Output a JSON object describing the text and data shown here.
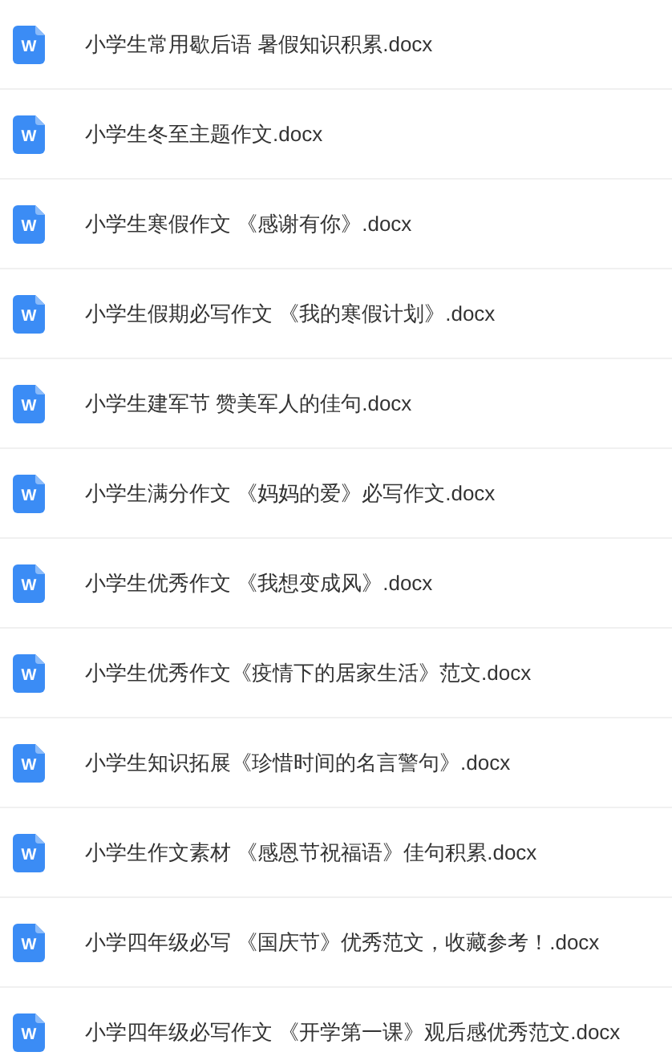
{
  "files": [
    {
      "icon_label": "W",
      "name": "小学生常用歇后语 暑假知识积累.docx"
    },
    {
      "icon_label": "W",
      "name": "小学生冬至主题作文.docx"
    },
    {
      "icon_label": "W",
      "name": "小学生寒假作文 《感谢有你》.docx"
    },
    {
      "icon_label": "W",
      "name": "小学生假期必写作文 《我的寒假计划》.docx"
    },
    {
      "icon_label": "W",
      "name": "小学生建军节 赞美军人的佳句.docx"
    },
    {
      "icon_label": "W",
      "name": "小学生满分作文 《妈妈的爱》必写作文.docx"
    },
    {
      "icon_label": "W",
      "name": "小学生优秀作文 《我想变成风》.docx"
    },
    {
      "icon_label": "W",
      "name": "小学生优秀作文《疫情下的居家生活》范文.docx"
    },
    {
      "icon_label": "W",
      "name": "小学生知识拓展《珍惜时间的名言警句》.docx"
    },
    {
      "icon_label": "W",
      "name": "小学生作文素材 《感恩节祝福语》佳句积累.docx"
    },
    {
      "icon_label": "W",
      "name": "小学四年级必写 《国庆节》优秀范文，收藏参考！.docx"
    },
    {
      "icon_label": "W",
      "name": "小学四年级必写作文 《开学第一课》观后感优秀范文.docx"
    }
  ]
}
